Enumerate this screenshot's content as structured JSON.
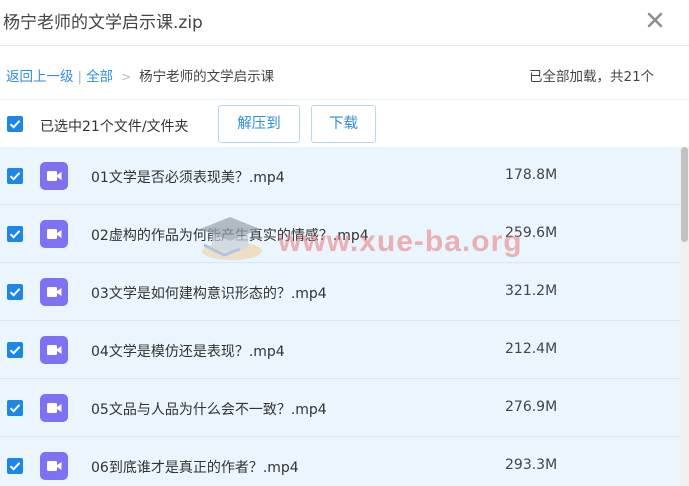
{
  "window": {
    "title": "杨宁老师的文学启示课.zip"
  },
  "nav": {
    "back_label": "返回上一级",
    "separator": "|",
    "all_label": "全部",
    "arrow": ">",
    "current_folder": "杨宁老师的文学启示课",
    "status": "已全部加载，共21个"
  },
  "actions": {
    "selection_label": "已选中21个文件/文件夹",
    "extract_label": "解压到",
    "download_label": "下载"
  },
  "files": [
    {
      "name": "01文学是否必须表现美？.mp4",
      "size": "178.8M",
      "icon": "video-icon"
    },
    {
      "name": "02虚构的作品为何能产生真实的情感？.mp4",
      "size": "259.6M",
      "icon": "video-icon"
    },
    {
      "name": "03文学是如何建构意识形态的？.mp4",
      "size": "321.2M",
      "icon": "video-icon"
    },
    {
      "name": "04文学是模仿还是表现？.mp4",
      "size": "212.4M",
      "icon": "video-icon"
    },
    {
      "name": "05文品与人品为什么会不一致？.mp4",
      "size": "276.9M",
      "icon": "video-icon"
    },
    {
      "name": "06到底谁才是真正的作者？.mp4",
      "size": "293.3M",
      "icon": "video-icon"
    }
  ],
  "watermark": {
    "text": "www.xue-ba.org"
  },
  "colors": {
    "accent": "#2e8ede",
    "checkbox": "#1e86e5",
    "row_background": "#eaf5fd",
    "video_icon": "#7e72f2"
  }
}
